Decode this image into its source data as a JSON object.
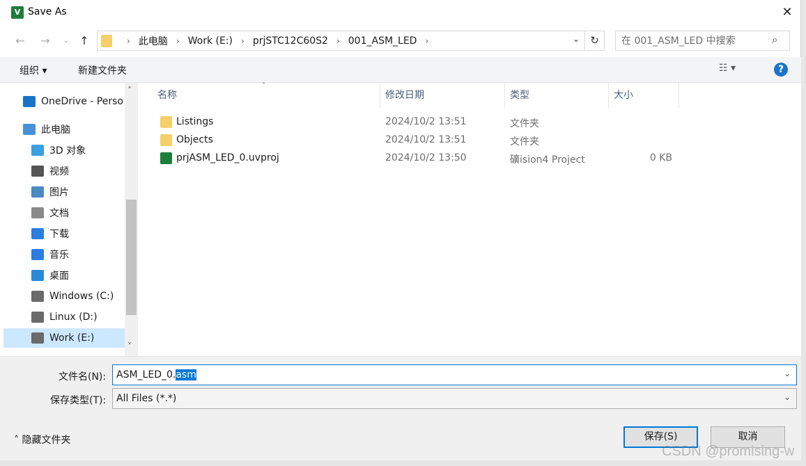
{
  "window": {
    "title": "Save As",
    "title_icon_letter": "V"
  },
  "address": {
    "crumbs": [
      "此电脑",
      "Work (E:)",
      "prjSTC12C60S2",
      "001_ASM_LED"
    ],
    "search_placeholder": "在 001_ASM_LED 中搜索"
  },
  "toolbar": {
    "organize": "组织 ▾",
    "new_folder": "新建文件夹",
    "help": "?"
  },
  "nav": [
    {
      "label": "OneDrive - Perso",
      "icon": "cloud-icon",
      "color": "#1a73c7"
    },
    {
      "label": "此电脑",
      "icon": "computer-icon",
      "color": "#4a90d9"
    },
    {
      "label": "3D 对象",
      "icon": "cube-icon",
      "color": "#3aa0e0"
    },
    {
      "label": "视频",
      "icon": "film-icon",
      "color": "#555555"
    },
    {
      "label": "图片",
      "icon": "picture-icon",
      "color": "#4a8ac4"
    },
    {
      "label": "文档",
      "icon": "document-icon",
      "color": "#8a8a8a"
    },
    {
      "label": "下载",
      "icon": "download-icon",
      "color": "#2a7de1"
    },
    {
      "label": "音乐",
      "icon": "music-icon",
      "color": "#2a7de1"
    },
    {
      "label": "桌面",
      "icon": "desktop-icon",
      "color": "#2a8ad8"
    },
    {
      "label": "Windows (C:)",
      "icon": "drive-icon",
      "color": "#6a6a6a"
    },
    {
      "label": "Linux (D:)",
      "icon": "drive-icon",
      "color": "#6a6a6a"
    },
    {
      "label": "Work (E:)",
      "icon": "drive-icon",
      "color": "#6a6a6a",
      "selected": true
    }
  ],
  "columns": {
    "name": "名称",
    "date": "修改日期",
    "type": "类型",
    "size": "大小"
  },
  "files": [
    {
      "name": "Listings",
      "date": "2024/10/2 13:51",
      "type": "文件夹",
      "size": "",
      "icon": "folder-icon"
    },
    {
      "name": "Objects",
      "date": "2024/10/2 13:51",
      "type": "文件夹",
      "size": "",
      "icon": "folder-icon"
    },
    {
      "name": "prjASM_LED_0.uvproj",
      "date": "2024/10/2 13:50",
      "type": "礦ision4 Project",
      "size": "0 KB",
      "icon": "uvision-icon"
    }
  ],
  "form": {
    "filename_label": "文件名(N):",
    "filename_value_base": "ASM_LED_0.",
    "filename_value_ext": "asm",
    "filetype_label": "保存类型(T):",
    "filetype_value": "All Files (*.*)"
  },
  "footer": {
    "hide_folders": "隐藏文件夹",
    "save": "保存(S)",
    "cancel": "取消"
  },
  "watermark": "CSDN @promising-w"
}
